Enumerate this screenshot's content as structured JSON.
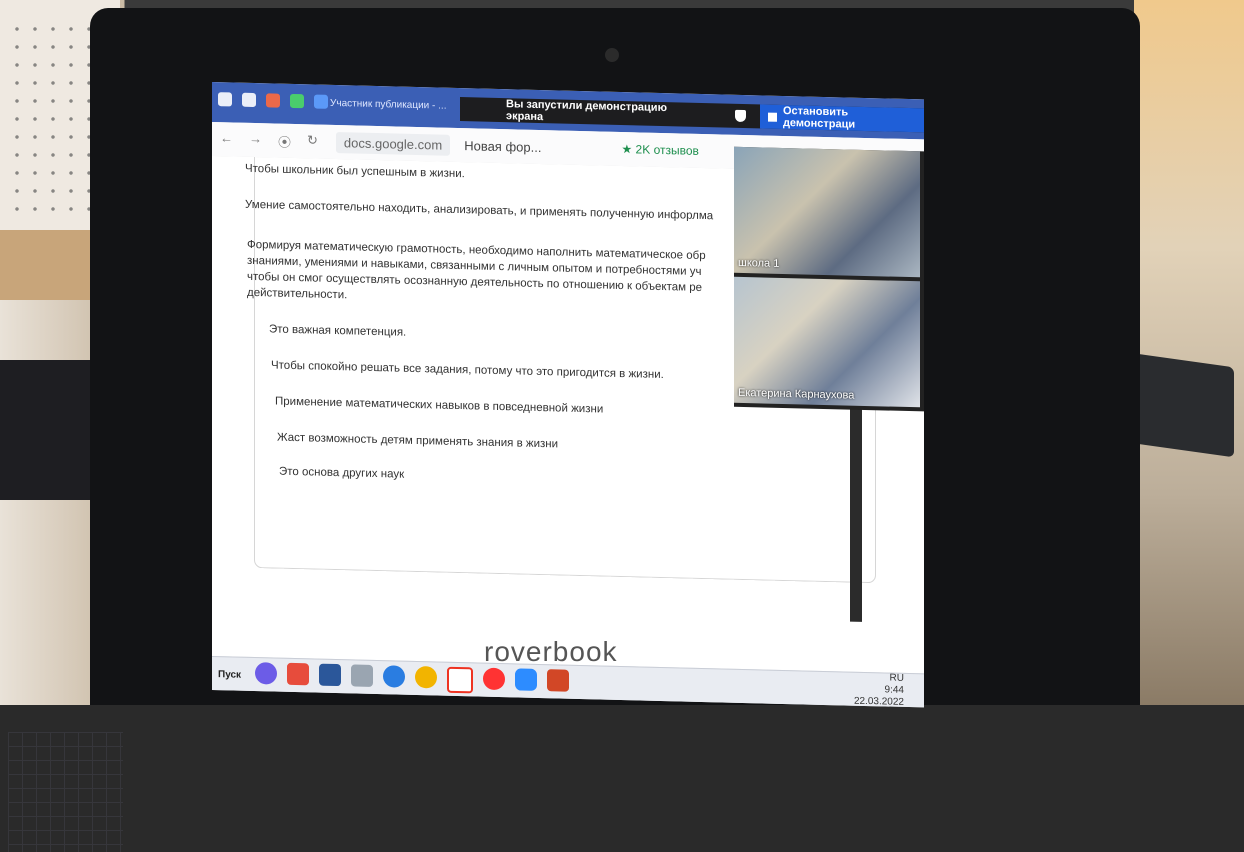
{
  "browser": {
    "tab_title": "Участник публикации - ...",
    "url": "docs.google.com",
    "page_title": "Новая фор...",
    "reviews_badge": "★ 2K отзывов"
  },
  "screen_share": {
    "message": "Вы запустили демонстрацию экрана",
    "stop_label": "Остановить демонстраци"
  },
  "form_responses": [
    "Чтобы школьник был успешным в жизни.",
    "Умение самостоятельно находить, анализировать, и применять полученную инфорлма",
    "Формируя математическую грамотность, необходимо наполнить математическое обр",
    "знаниями, умениями и навыками, связанными с личным опытом и потребностями уч",
    "чтобы он смог осуществлять осознанную деятельность по отношению к объектам ре",
    "действительности.",
    "Это важная компетенция.",
    "Чтобы спокойно решать все задания, потому что это пригодится в жизни.",
    "Применение математических навыков в повседневной жизни",
    "Жаст возможность детям применять знания в жизни",
    "Это основа других наук"
  ],
  "video_tiles": [
    {
      "label": "школа 1"
    },
    {
      "label": "Екатерина Карнаухова"
    }
  ],
  "taskbar": {
    "start_label": "Пуск",
    "lang": "RU",
    "time": "9:44",
    "date": "22.03.2022"
  },
  "laptop_brand": "roverbook",
  "colors": {
    "tabbar": "#3b5fb5",
    "stop_button": "#1f5fd8",
    "reviews_green": "#1e8f4e"
  }
}
